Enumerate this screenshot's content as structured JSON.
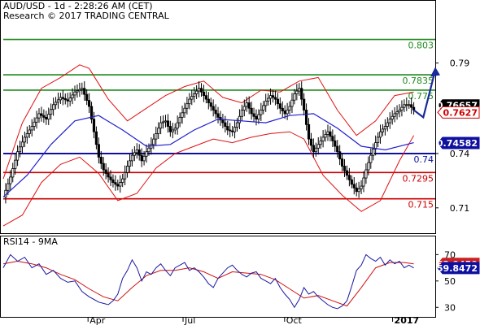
{
  "header": {
    "line1": "AUD/USD - 1d - 2:28:26 AM (CET)",
    "line2": "Research © 2017 TRADING CENTRAL"
  },
  "rsi_panel": {
    "label": "RSI14 - 9MA"
  },
  "colors": {
    "up_candle": "#ffffff",
    "candle_line": "#000000",
    "bollinger": "#e01010",
    "moving_average": "#2020d0",
    "resistance": "#1f8a1f",
    "support": "#cc0000",
    "pivot": "#1010a0",
    "forecast_arrow": "#1a2a9a",
    "rsi_line": "#1a1aa0",
    "rsi_ma": "#d01010"
  },
  "chart_data": [
    {
      "type": "candlestick",
      "title": "AUD/USD - 1d",
      "x_ticks": [
        "Apr",
        "Jul",
        "Oct",
        "2017"
      ],
      "y_ticks": [
        0.71,
        0.74,
        0.79
      ],
      "ylim": [
        0.696,
        0.823
      ],
      "price_tags": [
        {
          "value": 0.76657,
          "label": "0.76657",
          "style": "last"
        },
        {
          "value": 0.7627,
          "label": "0.7627",
          "style": "bollinger"
        },
        {
          "value": 0.74582,
          "label": "0.74582",
          "style": "ma"
        }
      ],
      "levels": [
        {
          "value": 0.803,
          "label": "0.803",
          "kind": "resistance"
        },
        {
          "value": 0.7835,
          "label": "0.7835",
          "kind": "resistance"
        },
        {
          "value": 0.775,
          "label": "0.775",
          "kind": "resistance"
        },
        {
          "value": 0.74,
          "label": "0.74",
          "kind": "pivot"
        },
        {
          "value": 0.7295,
          "label": "0.7295",
          "kind": "support"
        },
        {
          "value": 0.715,
          "label": "0.715",
          "kind": "support"
        }
      ],
      "price_path": [
        [
          0,
          0.716
        ],
        [
          3,
          0.727
        ],
        [
          6,
          0.741
        ],
        [
          9,
          0.749
        ],
        [
          12,
          0.755
        ],
        [
          15,
          0.762
        ],
        [
          18,
          0.759
        ],
        [
          21,
          0.767
        ],
        [
          24,
          0.771
        ],
        [
          27,
          0.769
        ],
        [
          30,
          0.774
        ],
        [
          33,
          0.776
        ],
        [
          36,
          0.766
        ],
        [
          38,
          0.752
        ],
        [
          40,
          0.738
        ],
        [
          42,
          0.731
        ],
        [
          44,
          0.727
        ],
        [
          46,
          0.724
        ],
        [
          48,
          0.722
        ],
        [
          50,
          0.726
        ],
        [
          52,
          0.733
        ],
        [
          54,
          0.739
        ],
        [
          56,
          0.742
        ],
        [
          58,
          0.736
        ],
        [
          60,
          0.741
        ],
        [
          62,
          0.745
        ],
        [
          64,
          0.751
        ],
        [
          66,
          0.757
        ],
        [
          68,
          0.758
        ],
        [
          70,
          0.752
        ],
        [
          72,
          0.754
        ],
        [
          74,
          0.76
        ],
        [
          76,
          0.765
        ],
        [
          78,
          0.77
        ],
        [
          80,
          0.773
        ],
        [
          82,
          0.776
        ],
        [
          84,
          0.772
        ],
        [
          86,
          0.768
        ],
        [
          88,
          0.764
        ],
        [
          90,
          0.76
        ],
        [
          92,
          0.757
        ],
        [
          94,
          0.753
        ],
        [
          96,
          0.752
        ],
        [
          98,
          0.757
        ],
        [
          100,
          0.764
        ],
        [
          102,
          0.768
        ],
        [
          104,
          0.762
        ],
        [
          106,
          0.759
        ],
        [
          108,
          0.764
        ],
        [
          110,
          0.769
        ],
        [
          112,
          0.772
        ],
        [
          114,
          0.77
        ],
        [
          116,
          0.765
        ],
        [
          118,
          0.762
        ],
        [
          120,
          0.766
        ],
        [
          122,
          0.773
        ],
        [
          124,
          0.776
        ],
        [
          126,
          0.764
        ],
        [
          128,
          0.748
        ],
        [
          130,
          0.741
        ],
        [
          132,
          0.745
        ],
        [
          134,
          0.749
        ],
        [
          136,
          0.752
        ],
        [
          138,
          0.747
        ],
        [
          140,
          0.741
        ],
        [
          142,
          0.733
        ],
        [
          144,
          0.728
        ],
        [
          146,
          0.723
        ],
        [
          148,
          0.719
        ],
        [
          150,
          0.722
        ],
        [
          152,
          0.731
        ],
        [
          154,
          0.739
        ],
        [
          156,
          0.746
        ],
        [
          158,
          0.752
        ],
        [
          160,
          0.755
        ],
        [
          162,
          0.759
        ],
        [
          164,
          0.762
        ],
        [
          166,
          0.764
        ],
        [
          168,
          0.767
        ],
        [
          170,
          0.767
        ],
        [
          172,
          0.764
        ]
      ],
      "moving_average": [
        [
          0,
          0.716
        ],
        [
          10,
          0.728
        ],
        [
          20,
          0.745
        ],
        [
          30,
          0.758
        ],
        [
          40,
          0.761
        ],
        [
          50,
          0.753
        ],
        [
          60,
          0.744
        ],
        [
          70,
          0.745
        ],
        [
          80,
          0.753
        ],
        [
          90,
          0.759
        ],
        [
          100,
          0.758
        ],
        [
          110,
          0.757
        ],
        [
          120,
          0.761
        ],
        [
          130,
          0.762
        ],
        [
          140,
          0.754
        ],
        [
          150,
          0.744
        ],
        [
          160,
          0.742
        ],
        [
          172,
          0.746
        ]
      ],
      "bollinger_upper": [
        [
          0,
          0.726
        ],
        [
          8,
          0.757
        ],
        [
          16,
          0.776
        ],
        [
          24,
          0.782
        ],
        [
          32,
          0.789
        ],
        [
          36,
          0.787
        ],
        [
          44,
          0.77
        ],
        [
          52,
          0.758
        ],
        [
          60,
          0.765
        ],
        [
          68,
          0.772
        ],
        [
          76,
          0.777
        ],
        [
          84,
          0.78
        ],
        [
          92,
          0.771
        ],
        [
          100,
          0.768
        ],
        [
          108,
          0.775
        ],
        [
          116,
          0.774
        ],
        [
          124,
          0.78
        ],
        [
          132,
          0.782
        ],
        [
          140,
          0.764
        ],
        [
          148,
          0.75
        ],
        [
          156,
          0.758
        ],
        [
          164,
          0.772
        ],
        [
          172,
          0.774
        ]
      ],
      "bollinger_lower": [
        [
          0,
          0.7
        ],
        [
          8,
          0.706
        ],
        [
          16,
          0.724
        ],
        [
          24,
          0.734
        ],
        [
          32,
          0.738
        ],
        [
          40,
          0.729
        ],
        [
          48,
          0.714
        ],
        [
          56,
          0.718
        ],
        [
          64,
          0.732
        ],
        [
          72,
          0.74
        ],
        [
          80,
          0.744
        ],
        [
          88,
          0.748
        ],
        [
          96,
          0.746
        ],
        [
          104,
          0.749
        ],
        [
          112,
          0.751
        ],
        [
          120,
          0.752
        ],
        [
          126,
          0.748
        ],
        [
          134,
          0.728
        ],
        [
          142,
          0.717
        ],
        [
          150,
          0.708
        ],
        [
          158,
          0.714
        ],
        [
          166,
          0.736
        ],
        [
          172,
          0.75
        ]
      ],
      "forecast": [
        [
          172,
          0.764
        ],
        [
          176,
          0.76
        ],
        [
          181,
          0.786
        ]
      ]
    },
    {
      "type": "line",
      "title": "RSI14 - 9MA",
      "y_ticks": [
        30,
        50,
        70
      ],
      "ylim": [
        24,
        77
      ],
      "value_tags": [
        {
          "value": 62.9459,
          "label": "62.9459",
          "style": "ma"
        },
        {
          "value": 59.8472,
          "label": "59.8472",
          "style": "rsi"
        }
      ],
      "series": [
        {
          "name": "RSI14",
          "values": [
            [
              0,
              60
            ],
            [
              3,
              70
            ],
            [
              6,
              65
            ],
            [
              9,
              68
            ],
            [
              12,
              60
            ],
            [
              15,
              63
            ],
            [
              18,
              55
            ],
            [
              21,
              58
            ],
            [
              24,
              52
            ],
            [
              27,
              49
            ],
            [
              30,
              50
            ],
            [
              33,
              42
            ],
            [
              36,
              38
            ],
            [
              38,
              36
            ],
            [
              40,
              34
            ],
            [
              42,
              33
            ],
            [
              44,
              32
            ],
            [
              46,
              35
            ],
            [
              48,
              40
            ],
            [
              50,
              52
            ],
            [
              52,
              58
            ],
            [
              54,
              66
            ],
            [
              56,
              60
            ],
            [
              58,
              50
            ],
            [
              60,
              57
            ],
            [
              62,
              55
            ],
            [
              64,
              60
            ],
            [
              66,
              63
            ],
            [
              68,
              58
            ],
            [
              70,
              54
            ],
            [
              72,
              60
            ],
            [
              74,
              62
            ],
            [
              76,
              64
            ],
            [
              78,
              58
            ],
            [
              80,
              60
            ],
            [
              82,
              57
            ],
            [
              84,
              53
            ],
            [
              86,
              48
            ],
            [
              88,
              45
            ],
            [
              90,
              52
            ],
            [
              92,
              56
            ],
            [
              94,
              60
            ],
            [
              96,
              62
            ],
            [
              98,
              58
            ],
            [
              100,
              55
            ],
            [
              102,
              53
            ],
            [
              104,
              56
            ],
            [
              106,
              57
            ],
            [
              108,
              52
            ],
            [
              110,
              50
            ],
            [
              112,
              48
            ],
            [
              114,
              52
            ],
            [
              116,
              45
            ],
            [
              118,
              40
            ],
            [
              120,
              36
            ],
            [
              122,
              30
            ],
            [
              124,
              36
            ],
            [
              126,
              45
            ],
            [
              128,
              40
            ],
            [
              130,
              42
            ],
            [
              132,
              38
            ],
            [
              134,
              35
            ],
            [
              136,
              32
            ],
            [
              138,
              30
            ],
            [
              140,
              29
            ],
            [
              142,
              31
            ],
            [
              144,
              35
            ],
            [
              146,
              46
            ],
            [
              148,
              58
            ],
            [
              150,
              62
            ],
            [
              152,
              70
            ],
            [
              154,
              67
            ],
            [
              156,
              65
            ],
            [
              158,
              68
            ],
            [
              160,
              62
            ],
            [
              162,
              66
            ],
            [
              164,
              63
            ],
            [
              166,
              65
            ],
            [
              168,
              60
            ],
            [
              170,
              62
            ],
            [
              172,
              59.85
            ]
          ]
        },
        {
          "name": "9MA",
          "values": [
            [
              0,
              63
            ],
            [
              6,
              65
            ],
            [
              12,
              63
            ],
            [
              18,
              60
            ],
            [
              24,
              55
            ],
            [
              30,
              51
            ],
            [
              36,
              44
            ],
            [
              42,
              38
            ],
            [
              48,
              35
            ],
            [
              54,
              45
            ],
            [
              60,
              54
            ],
            [
              66,
              58
            ],
            [
              72,
              58
            ],
            [
              78,
              60
            ],
            [
              84,
              57
            ],
            [
              90,
              52
            ],
            [
              96,
              57
            ],
            [
              102,
              56
            ],
            [
              108,
              55
            ],
            [
              114,
              51
            ],
            [
              120,
              44
            ],
            [
              126,
              37
            ],
            [
              132,
              39
            ],
            [
              138,
              35
            ],
            [
              144,
              31
            ],
            [
              150,
              45
            ],
            [
              156,
              60
            ],
            [
              162,
              64
            ],
            [
              168,
              64
            ],
            [
              172,
              62.95
            ]
          ]
        }
      ]
    }
  ]
}
